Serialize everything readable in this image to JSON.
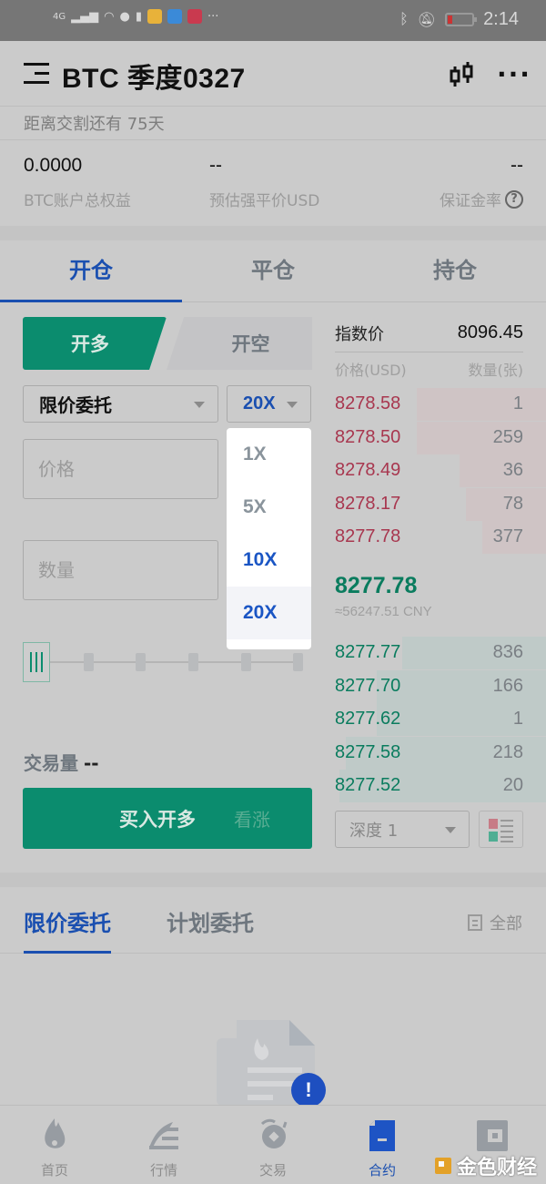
{
  "status_bar": {
    "network": "4G",
    "time": "2:14",
    "more": "···"
  },
  "header": {
    "title": "BTC 季度0327",
    "menu_icon": "menu-arrow-icon",
    "kline_icon": "candlestick-icon",
    "more_icon": "more-dots-icon",
    "more_label": "···"
  },
  "delivery": {
    "text": "距离交割还有 75天"
  },
  "account": {
    "equity_value": "0.0000",
    "equity_label": "BTC账户总权益",
    "liq_value": "--",
    "liq_label": "预估强平价USD",
    "margin_value": "--",
    "margin_label": "保证金率",
    "help_icon": "?"
  },
  "tabs": [
    {
      "label": "开仓",
      "active": true
    },
    {
      "label": "平仓",
      "active": false
    },
    {
      "label": "持仓",
      "active": false
    }
  ],
  "trade_form": {
    "long_label": "开多",
    "short_label": "开空",
    "order_type": "限价委托",
    "leverage": "20X",
    "price_placeholder": "价格",
    "quantity_placeholder": "数量",
    "slider_value_percent": 0,
    "volume_label": "交易量",
    "volume_value": "--",
    "buy_button_label": "买入开多",
    "buy_button_hint": "看涨"
  },
  "leverage_dropdown": {
    "options": [
      {
        "label": "1X",
        "state": "disabled"
      },
      {
        "label": "5X",
        "state": "disabled"
      },
      {
        "label": "10X",
        "state": "enabled"
      },
      {
        "label": "20X",
        "state": "selected"
      }
    ]
  },
  "order_book": {
    "index_label": "指数价",
    "index_price": "8096.45",
    "price_header": "价格(USD)",
    "qty_header": "数量(张)",
    "asks": [
      {
        "price": "8278.58",
        "qty": "1",
        "depth": 0.61
      },
      {
        "price": "8278.50",
        "qty": "259",
        "depth": 0.61
      },
      {
        "price": "8278.49",
        "qty": "36",
        "depth": 0.41
      },
      {
        "price": "8278.17",
        "qty": "78",
        "depth": 0.38
      },
      {
        "price": "8277.78",
        "qty": "377",
        "depth": 0.3
      }
    ],
    "last_price": "8277.78",
    "last_price_cny": "≈56247.51 CNY",
    "bids": [
      {
        "price": "8277.77",
        "qty": "836",
        "depth": 0.68
      },
      {
        "price": "8277.70",
        "qty": "166",
        "depth": 0.8
      },
      {
        "price": "8277.62",
        "qty": "1",
        "depth": 0.8
      },
      {
        "price": "8277.58",
        "qty": "218",
        "depth": 0.95
      },
      {
        "price": "8277.52",
        "qty": "20",
        "depth": 0.98
      }
    ],
    "depth_select": "深度 1"
  },
  "orders": {
    "tabs": [
      {
        "label": "限价委托",
        "active": true
      },
      {
        "label": "计划委托",
        "active": false
      }
    ],
    "all_label": "全部"
  },
  "bottom_nav": [
    {
      "label": "首页",
      "icon": "flame-icon",
      "active": false
    },
    {
      "label": "行情",
      "icon": "market-chart-icon",
      "active": false
    },
    {
      "label": "交易",
      "icon": "exchange-coin-icon",
      "active": false
    },
    {
      "label": "合约",
      "icon": "contract-doc-icon",
      "active": true
    },
    {
      "label": "",
      "icon": "wallet-icon",
      "active": false
    }
  ],
  "watermark": {
    "text": "金色财经"
  },
  "colors": {
    "accent_blue": "#1a4fb0",
    "long_green": "#0b8c6e",
    "ask_red": "#a8374f",
    "bid_green": "#0a7c5e",
    "overlay_bg": "#cbcbcb"
  }
}
